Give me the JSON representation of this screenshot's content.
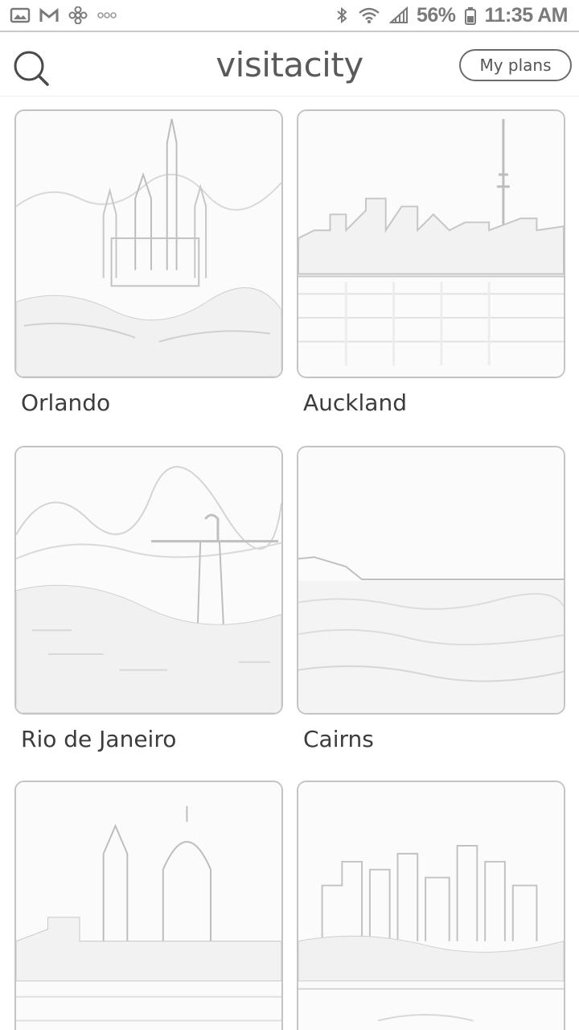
{
  "status_bar": {
    "left_icons": [
      "gallery-icon",
      "gmail-icon",
      "pinwheel-icon",
      "more-dots-icon"
    ],
    "right_icons": [
      "bluetooth-icon",
      "wifi-icon",
      "signal-icon",
      "battery-icon"
    ],
    "battery": "56%",
    "time": "11:35 AM"
  },
  "header": {
    "brand": "visitacity",
    "my_plans_label": "My plans",
    "search_icon": "search-icon"
  },
  "cities": [
    {
      "name": "Orlando"
    },
    {
      "name": "Auckland"
    },
    {
      "name": "Rio de Janeiro"
    },
    {
      "name": "Cairns"
    },
    {
      "name": ""
    },
    {
      "name": ""
    }
  ]
}
